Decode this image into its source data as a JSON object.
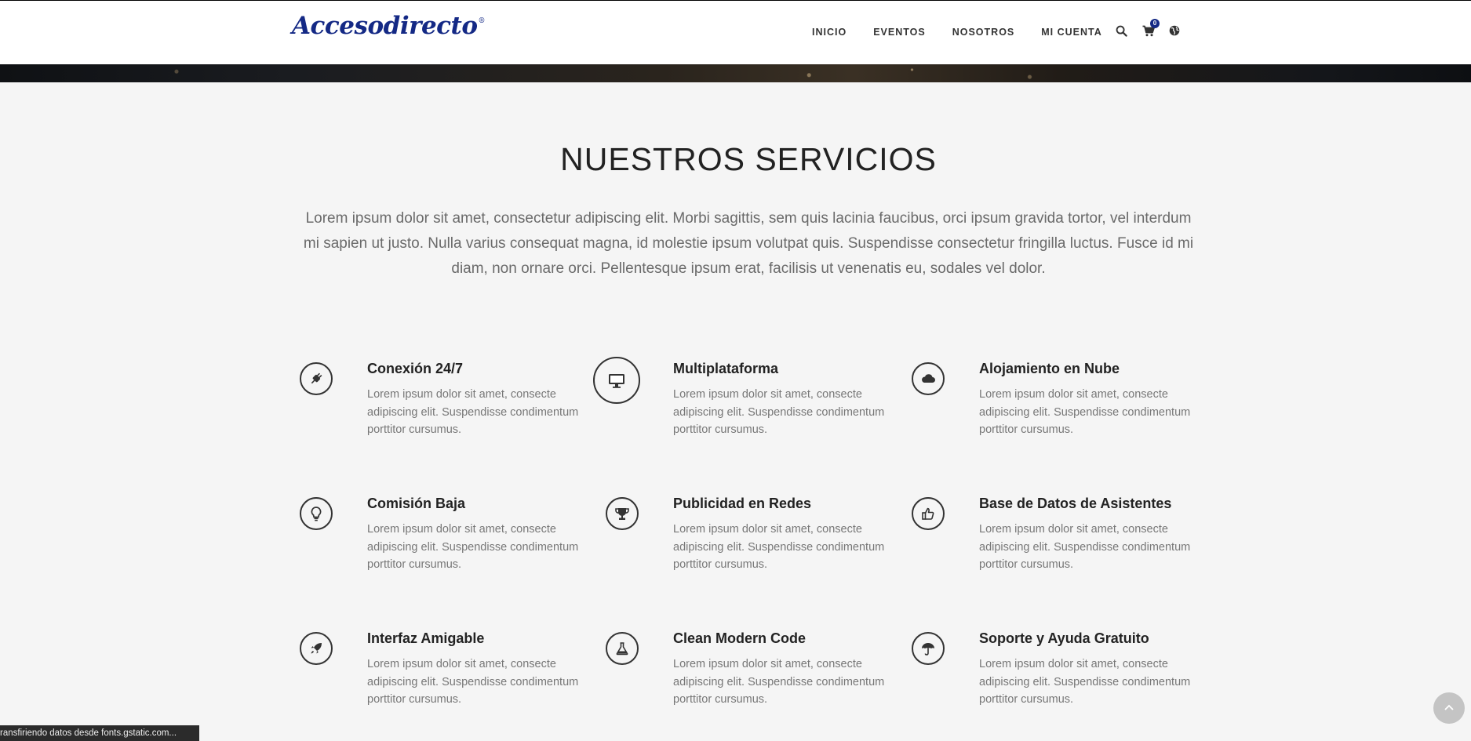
{
  "header": {
    "logo_text": "Accesodirecto",
    "logo_mark": "®",
    "nav": [
      {
        "label": "INICIO"
      },
      {
        "label": "EVENTOS"
      },
      {
        "label": "NOSOTROS"
      },
      {
        "label": "MI CUENTA"
      }
    ],
    "cart_count": "0",
    "icons": [
      "search-icon",
      "cart-icon",
      "globe-icon"
    ]
  },
  "section": {
    "title": "NUESTROS SERVICIOS",
    "intro": "Lorem ipsum dolor sit amet, consectetur adipiscing elit. Morbi sagittis, sem quis lacinia faucibus, orci ipsum gravida tortor, vel interdum mi sapien ut justo. Nulla varius consequat magna, id molestie ipsum volutpat quis. Suspendisse consectetur fringilla luctus. Fusce id mi diam, non ornare orci. Pellentesque ipsum erat, facilisis ut venenatis eu, sodales vel dolor."
  },
  "services": [
    {
      "title": "Conexión 24/7",
      "desc": "Lorem ipsum dolor sit amet, consecte adipiscing elit. Suspendisse condimentum porttitor cursumus.",
      "icon": "plug-icon"
    },
    {
      "title": "Multiplataforma",
      "desc": "Lorem ipsum dolor sit amet, consecte adipiscing elit. Suspendisse condimentum porttitor cursumus.",
      "icon": "desktop-icon"
    },
    {
      "title": "Alojamiento en Nube",
      "desc": "Lorem ipsum dolor sit amet, consecte adipiscing elit. Suspendisse condimentum porttitor cursumus.",
      "icon": "cloud-icon"
    },
    {
      "title": "Comisión Baja",
      "desc": "Lorem ipsum dolor sit amet, consecte adipiscing elit. Suspendisse condimentum porttitor cursumus.",
      "icon": "lightbulb-icon"
    },
    {
      "title": "Publicidad en Redes",
      "desc": "Lorem ipsum dolor sit amet, consecte adipiscing elit. Suspendisse condimentum porttitor cursumus.",
      "icon": "trophy-icon"
    },
    {
      "title": "Base de Datos de Asistentes",
      "desc": "Lorem ipsum dolor sit amet, consecte adipiscing elit. Suspendisse condimentum porttitor cursumus.",
      "icon": "thumbs-up-icon"
    },
    {
      "title": "Interfaz Amigable",
      "desc": "Lorem ipsum dolor sit amet, consecte adipiscing elit. Suspendisse condimentum porttitor cursumus.",
      "icon": "rocket-icon"
    },
    {
      "title": "Clean Modern Code",
      "desc": "Lorem ipsum dolor sit amet, consecte adipiscing elit. Suspendisse condimentum porttitor cursumus.",
      "icon": "flask-icon"
    },
    {
      "title": "Soporte y Ayuda Gratuito",
      "desc": "Lorem ipsum dolor sit amet, consecte adipiscing elit. Suspendisse condimentum porttitor cursumus.",
      "icon": "umbrella-icon"
    }
  ],
  "status_bar": {
    "text": "ransfiriendo datos desde fonts.gstatic.com..."
  },
  "colors": {
    "brand": "#142985",
    "background": "#f5f5f5",
    "text": "#222222",
    "muted": "#777777"
  }
}
